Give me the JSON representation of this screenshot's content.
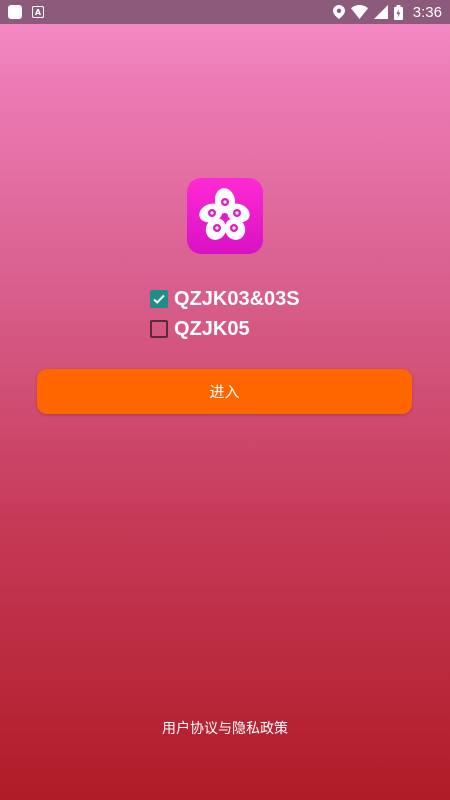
{
  "status_bar": {
    "time": "3:36",
    "icons": [
      "app-icon",
      "a-icon",
      "location-icon",
      "wifi-icon",
      "signal-icon",
      "battery-icon"
    ]
  },
  "logo": {
    "icon": "flower-logo-icon",
    "color": "#ff2ad2"
  },
  "options": [
    {
      "label": "QZJK03&03S",
      "checked": true
    },
    {
      "label": "QZJK05",
      "checked": false
    }
  ],
  "enter_button": {
    "label": "进入",
    "color": "#ff6600"
  },
  "footer": {
    "privacy_link": "用户协议与隐私政策"
  },
  "colors": {
    "checkbox_checked": "#1d8e8a",
    "status_bar": "#8c5a7a"
  }
}
